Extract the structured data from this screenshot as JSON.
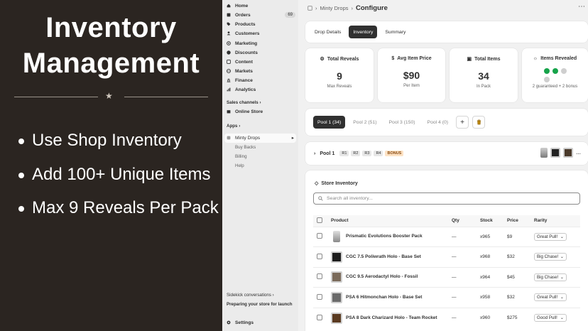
{
  "promo": {
    "title_line1": "Inventory",
    "title_line2": "Management",
    "bullets": [
      "Use Shop Inventory",
      "Add 100+ Unique Items",
      "Max 9 Reveals Per Pack"
    ]
  },
  "sidebar": {
    "items": [
      {
        "label": "Home",
        "icon": "home-icon"
      },
      {
        "label": "Orders",
        "icon": "orders-icon",
        "badge": "69"
      },
      {
        "label": "Products",
        "icon": "tag-icon"
      },
      {
        "label": "Customers",
        "icon": "person-icon"
      },
      {
        "label": "Marketing",
        "icon": "target-icon"
      },
      {
        "label": "Discounts",
        "icon": "discount-icon"
      },
      {
        "label": "Content",
        "icon": "content-icon"
      },
      {
        "label": "Markets",
        "icon": "globe-icon"
      },
      {
        "label": "Finance",
        "icon": "bank-icon"
      },
      {
        "label": "Analytics",
        "icon": "bar-chart-icon"
      }
    ],
    "sales_channels_label": "Sales channels",
    "online_store": "Online Store",
    "apps_label": "Apps",
    "app_name": "Minty Drops",
    "app_subitems": [
      "Buy Backs",
      "Billing",
      "Help"
    ],
    "sidekick": "Sidekick conversations",
    "preparing": "Preparing your store for launch",
    "settings": "Settings"
  },
  "topbar": {
    "app": "Minty Drops",
    "title": "Configure"
  },
  "tabs": [
    "Drop Details",
    "Inventory",
    "Summary"
  ],
  "stats": [
    {
      "label": "Total Reveals",
      "value": "9",
      "sub": "Max Reveals"
    },
    {
      "label": "Avg Item Price",
      "value": "$90",
      "sub": "Per Item"
    },
    {
      "label": "Total Items",
      "value": "34",
      "sub": "In Pack"
    },
    {
      "label": "Items Revealed",
      "sub": "2 guaranteed + 2 bonus"
    }
  ],
  "revealed_dots": [
    "#16a34a",
    "#16a34a",
    "#cfcfcf",
    "#cfcfcf"
  ],
  "pools": [
    "Pool 1 (34)",
    "Pool 2 (51)",
    "Pool 3 (150)",
    "Pool 4 (0)"
  ],
  "pool_row": {
    "name": "Pool 1",
    "chips": [
      "R1",
      "R2",
      "R3",
      "R4"
    ],
    "bonus": "BONUS"
  },
  "inventory": {
    "title": "Store Inventory",
    "search_placeholder": "Search all inventory...",
    "headers": {
      "product": "Product",
      "qty": "Qty",
      "stock": "Stock",
      "price": "Price",
      "rarity": "Rarity"
    },
    "rows": [
      {
        "product": "Prismatic Evolutions Booster Pack",
        "qty": "—",
        "stock": "x965",
        "price": "$9",
        "rarity": "Great Pull!"
      },
      {
        "product": "CGC 7.5 Poliwrath Holo - Base Set",
        "qty": "—",
        "stock": "x968",
        "price": "$32",
        "rarity": "Big Chase!"
      },
      {
        "product": "CGC 9.5 Aerodactyl Holo - Fossil",
        "qty": "—",
        "stock": "x964",
        "price": "$45",
        "rarity": "Big Chase!"
      },
      {
        "product": "PSA 6 Hitmonchan Holo - Base Set",
        "qty": "—",
        "stock": "x958",
        "price": "$32",
        "rarity": "Great Pull!"
      },
      {
        "product": "PSA 8 Dark Charizard Holo - Team Rocket",
        "qty": "—",
        "stock": "x960",
        "price": "$275",
        "rarity": "Good Pull!"
      }
    ]
  },
  "colors": {
    "promo_bg": "#2b2521",
    "accent_dark": "#303030",
    "success": "#16a34a"
  }
}
